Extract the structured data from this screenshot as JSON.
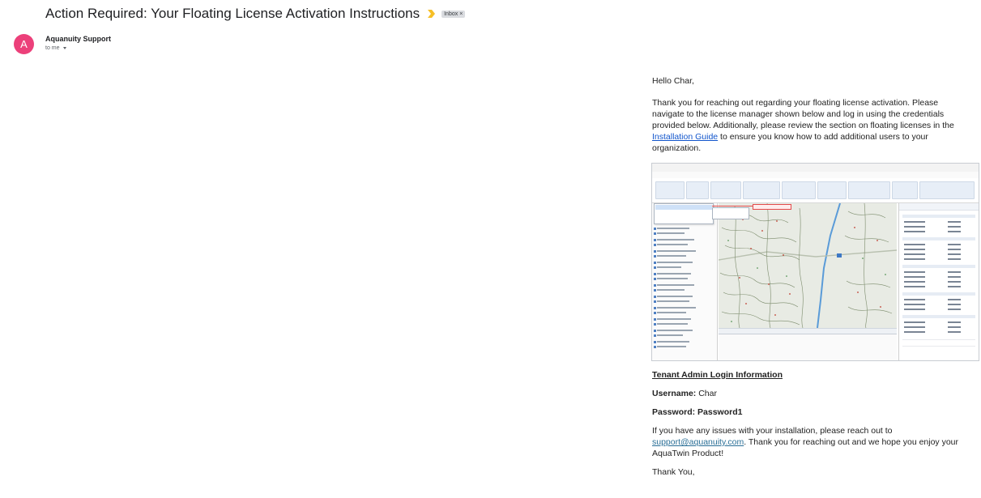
{
  "email": {
    "subject": "Action Required: Your Floating License Activation Instructions",
    "label": "Inbox",
    "label_close": "×",
    "sender": "Aquanuity Support",
    "avatar_letter": "A",
    "recipient": "to me"
  },
  "body": {
    "greeting": "Hello Char,",
    "para1_part1": "Thank you for reaching out regarding your floating license activation. Please navigate to the license manager shown below and log in using the credentials provided below. Additionally, please review the section on floating licenses in the ",
    "para1_link": "Installation Guide",
    "para1_part2": " to ensure you know how to add additional users to your organization.",
    "login_heading": "Tenant Admin Login Information",
    "username_label": "Username:",
    "username_value": " Char",
    "password_label": "Password:",
    "password_value": " Password1",
    "issues_part1": "If you have any issues with your installation, please reach out to ",
    "issues_link": "support@aquanuity.com",
    "issues_part2": ". Thank you for reaching out and we hope you enjoy your AquaTwin Product!",
    "signoff": "Thank You,"
  },
  "colors": {
    "avatar": "#ec407a",
    "link": "#1155cc",
    "importance": "#f6bf26"
  },
  "icons": {
    "importance": "importance-marker-icon",
    "dropdown": "chevron-down-icon"
  }
}
